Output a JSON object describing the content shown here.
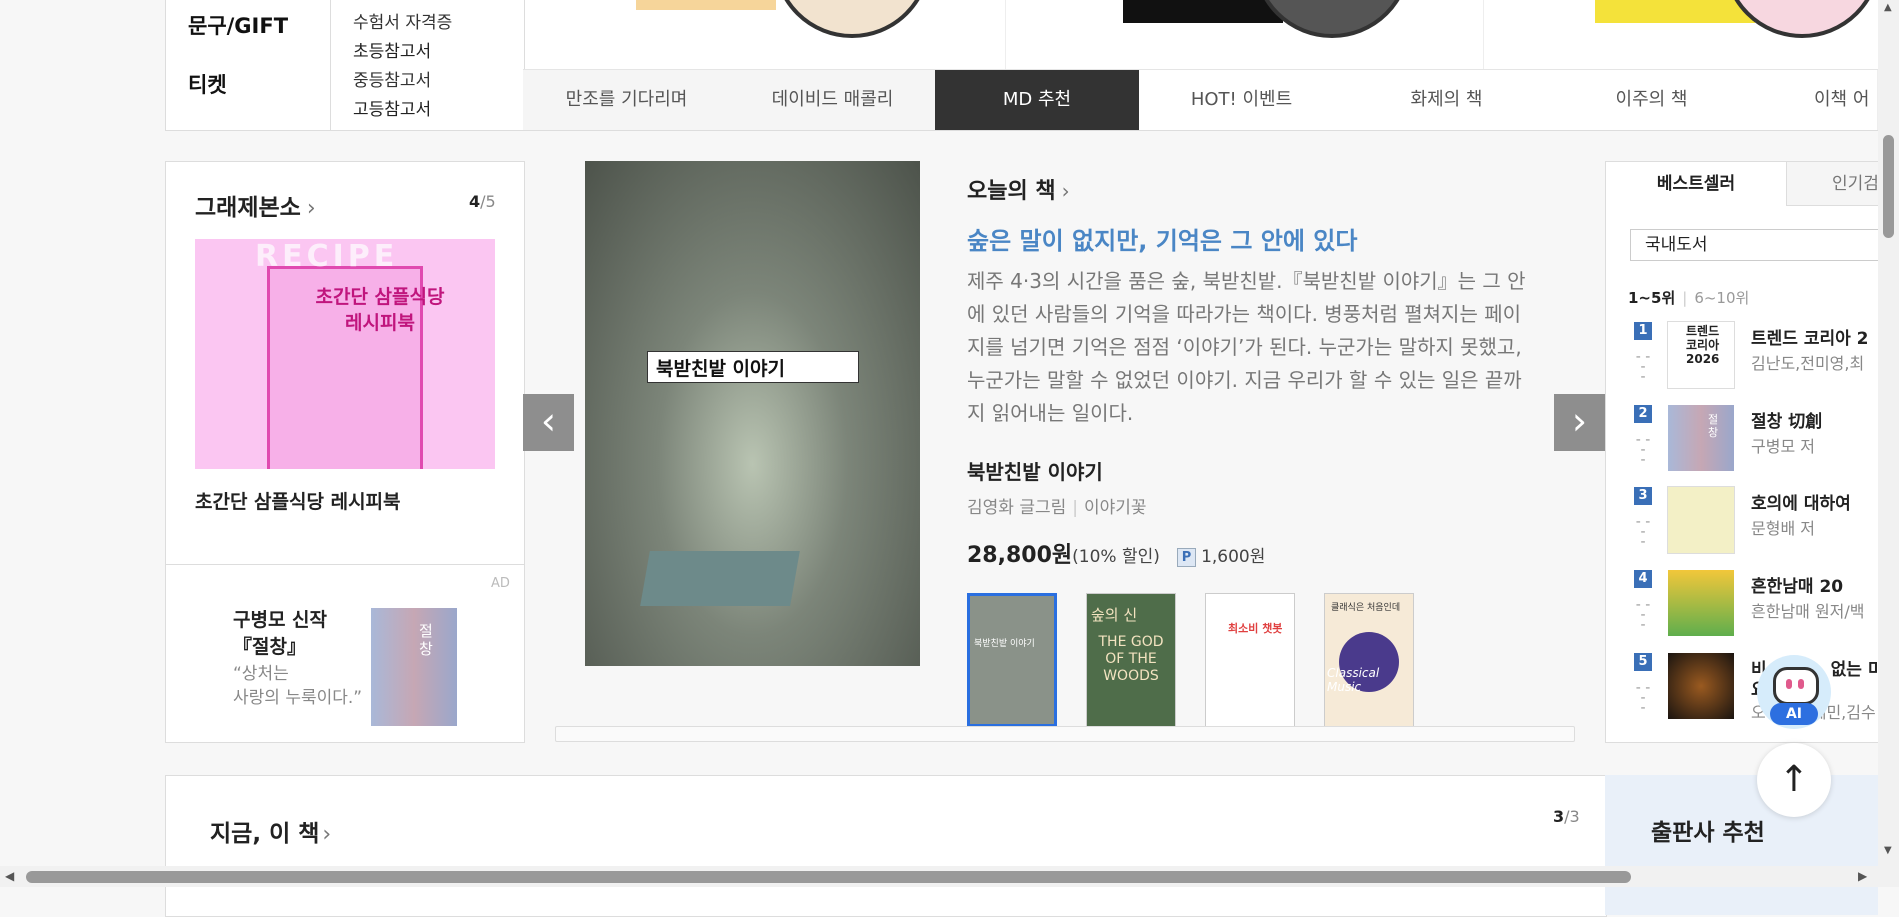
{
  "categories": {
    "main": [
      "문구/GIFT",
      "티켓"
    ],
    "sub": [
      "수험서 자격증",
      "초등참고서",
      "중등참고서",
      "고등참고서"
    ]
  },
  "tabs": [
    "만조를 기다리며",
    "데이비드 매콜리",
    "MD 추천",
    "HOT! 이벤트",
    "화제의 책",
    "이주의 책",
    "이책 어"
  ],
  "active_tab": "MD 추천",
  "left": {
    "title": "그래제본소",
    "page_current": "4",
    "page_total": "/5",
    "book_title": "초간단 삼플식당 레시피북",
    "cover_text": "초간단 삼플식당 레시피북",
    "ad_label": "AD",
    "ad_title_1": "구병모 신작",
    "ad_title_2": "『절창』",
    "ad_quote_1": "“상처는",
    "ad_quote_2": "사랑의 누룩이다.”",
    "ad_cover_text": "절창"
  },
  "center": {
    "section_title": "오늘의 책",
    "headline": "숲은 말이 없지만, 기억은 그 안에 있다",
    "description": "제주 4·3의 시간을 품은 숲, 북받친밭.『북받친밭 이야기』는 그 안에 있던 사람들의 기억을 따라가는 책이다. 병풍처럼 펼쳐지는 페이지를 넘기면 기억은 점점 ‘이야기’가 된다. 누군가는 말하지 못했고, 누군가는 말할 수 없었던 이야기. 지금 우리가 할 수 있는 일은 끝까지 읽어내는 일이다.",
    "book_title": "북받친밭 이야기",
    "author": "김영화 글그림",
    "publisher": "이야기꽃",
    "price": "28,800원",
    "discount": "(10% 할인)",
    "point_badge": "P",
    "points": "1,600원",
    "cover_label": "북받친밭 이야기",
    "thumbs": [
      "북받친밭 이야기",
      "숲의 신",
      "최소비 챗봇",
      "클래식은 처음인데"
    ],
    "thumb_texts": [
      "THE GOD OF THE WOODS",
      "Classical Music"
    ]
  },
  "right": {
    "tabs": [
      "베스트셀러",
      "인기검"
    ],
    "select_value": "국내도서",
    "range_active": "1~5위",
    "range_other": "6~10위",
    "items": [
      {
        "rank": "1",
        "title": "트렌드 코리아 2",
        "author": "김난도,전미영,최",
        "cover": "트렌드 코리아 2026"
      },
      {
        "rank": "2",
        "title": "절창 切創",
        "author": "구병모 저",
        "cover": "절창"
      },
      {
        "rank": "3",
        "title": "호의에 대하여",
        "author": "문형배 저",
        "cover": ""
      },
      {
        "rank": "4",
        "title": "흔한남매 20",
        "author": "흔한남매 원저/백",
        "cover": ""
      },
      {
        "rank": "5",
        "title": "비",
        "author": "오",
        "cover": ""
      }
    ],
    "rank5_extra": "없는 미",
    "rank5_line2": "요",
    "rank5_author_tail": "혜민,김수"
  },
  "bottom": {
    "title": "지금, 이 책",
    "page_current": "3",
    "page_total": "/3",
    "publisher_title": "출판사 추천"
  },
  "floating": {
    "ai_label": "AI"
  },
  "colors": {
    "accent": "#4a86c5",
    "tab_active": "#333333",
    "rank": "#3a6fb7"
  }
}
